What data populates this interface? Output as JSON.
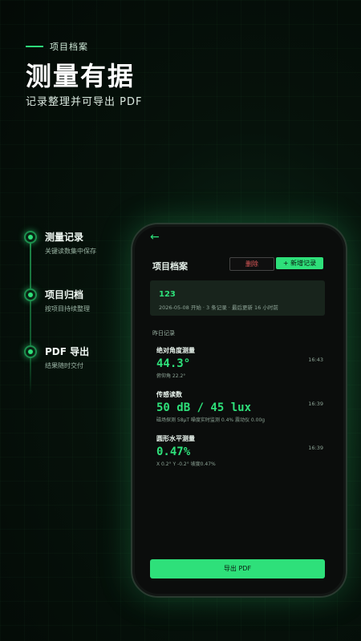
{
  "header": {
    "eyebrow": "项目档案",
    "title": "测量有据",
    "subtitle": "记录整理并可导出 PDF"
  },
  "features": [
    {
      "title": "测量记录",
      "desc": "关键读数集中保存"
    },
    {
      "title": "项目归档",
      "desc": "按项目持续整理"
    },
    {
      "title": "PDF 导出",
      "desc": "结果随时交付"
    }
  ],
  "phone": {
    "back_icon": "←",
    "title": "项目档案",
    "delete_label": "删除",
    "add_label": "+ 新增记录",
    "project": {
      "name": "123",
      "meta": "2026-05-08 开始 · 3 条记录 · 最后更新 16 小时前"
    },
    "section_label": "昨日记录",
    "records": [
      {
        "title": "绝对角度测量",
        "value": "44.3°",
        "detail": "俯仰角 22.2°",
        "time": "16:43"
      },
      {
        "title": "传感读数",
        "value": "50 dB / 45 lux",
        "detail": "磁场探测 58μT  噪度实时监测 0.4%  震动仪 0.00g",
        "time": "16:39"
      },
      {
        "title": "圆形水平测量",
        "value": "0.47%",
        "detail": "X 0.2°  Y -0.2°  坡度0.47%",
        "time": "16:39"
      }
    ],
    "export_label": "导出 PDF"
  },
  "colors": {
    "accent": "#2ee07a",
    "danger": "#e05a5a",
    "background": "#06120b"
  }
}
